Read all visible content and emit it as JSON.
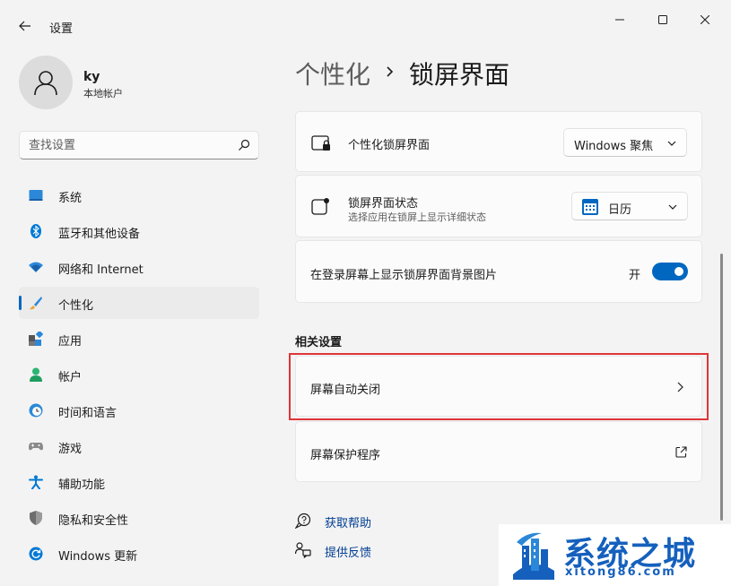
{
  "window": {
    "app_title": "设置"
  },
  "profile": {
    "name": "ky",
    "account_type": "本地帐户"
  },
  "search": {
    "placeholder": "查找设置"
  },
  "sidebar": {
    "items": [
      {
        "label": "系统",
        "icon": "system-icon",
        "selected": false
      },
      {
        "label": "蓝牙和其他设备",
        "icon": "bluetooth-icon",
        "selected": false
      },
      {
        "label": "网络和 Internet",
        "icon": "wifi-icon",
        "selected": false
      },
      {
        "label": "个性化",
        "icon": "paintbrush-icon",
        "selected": true
      },
      {
        "label": "应用",
        "icon": "apps-icon",
        "selected": false
      },
      {
        "label": "帐户",
        "icon": "person-icon",
        "selected": false
      },
      {
        "label": "时间和语言",
        "icon": "clock-globe-icon",
        "selected": false
      },
      {
        "label": "游戏",
        "icon": "gamepad-icon",
        "selected": false
      },
      {
        "label": "辅助功能",
        "icon": "accessibility-icon",
        "selected": false
      },
      {
        "label": "隐私和安全性",
        "icon": "shield-icon",
        "selected": false
      },
      {
        "label": "Windows 更新",
        "icon": "update-icon",
        "selected": false
      }
    ]
  },
  "breadcrumb": {
    "parent": "个性化",
    "current": "锁屏界面"
  },
  "settings": {
    "personalize_lock_screen": {
      "title": "个性化锁屏界面",
      "value": "Windows 聚焦"
    },
    "lock_screen_status": {
      "title": "锁屏界面状态",
      "subtitle": "选择应用在锁屏上显示详细状态",
      "value": "日历"
    },
    "show_background_on_signin": {
      "title": "在登录屏幕上显示锁屏界面背景图片",
      "state_label": "开",
      "on": true
    }
  },
  "related": {
    "heading": "相关设置",
    "screen_timeout": "屏幕自动关闭",
    "screen_saver": "屏幕保护程序"
  },
  "help": {
    "get_help": "获取帮助",
    "feedback": "提供反馈"
  },
  "watermark": {
    "title": "系统之城",
    "url": "xitong86.com"
  },
  "colors": {
    "accent": "#0067c0",
    "highlight_box": "#e0353a",
    "watermark": "#1560bd"
  }
}
